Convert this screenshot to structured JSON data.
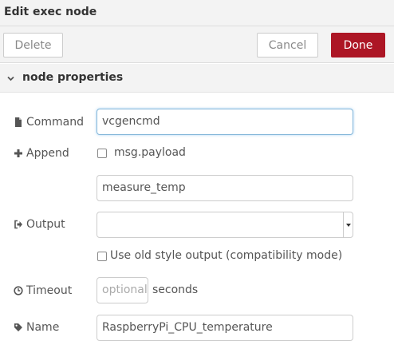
{
  "header": {
    "title": "Edit exec node"
  },
  "toolbar": {
    "delete_label": "Delete",
    "cancel_label": "Cancel",
    "done_label": "Done"
  },
  "section": {
    "title": "node properties",
    "icon": "chevron-down-icon"
  },
  "form": {
    "command": {
      "label": "Command",
      "icon": "file-icon",
      "value": "vcgencmd"
    },
    "append": {
      "label": "Append",
      "icon": "plus-icon",
      "checkbox_label": "msg.payload",
      "checkbox_checked": false,
      "extra_value": "measure_temp"
    },
    "output": {
      "label": "Output",
      "icon": "sign-out-icon",
      "selected": "",
      "old_style_label": "Use old style output (compatibility mode)",
      "old_style_checked": false
    },
    "timeout": {
      "label": "Timeout",
      "icon": "clock-icon",
      "placeholder": "optional",
      "suffix": "seconds"
    },
    "name": {
      "label": "Name",
      "icon": "tag-icon",
      "value": "RaspberryPi_CPU_temperature"
    }
  },
  "colors": {
    "done_bg": "#ad1625",
    "panel_bg": "#f3f3f3",
    "focus_border": "#85b7d9"
  }
}
